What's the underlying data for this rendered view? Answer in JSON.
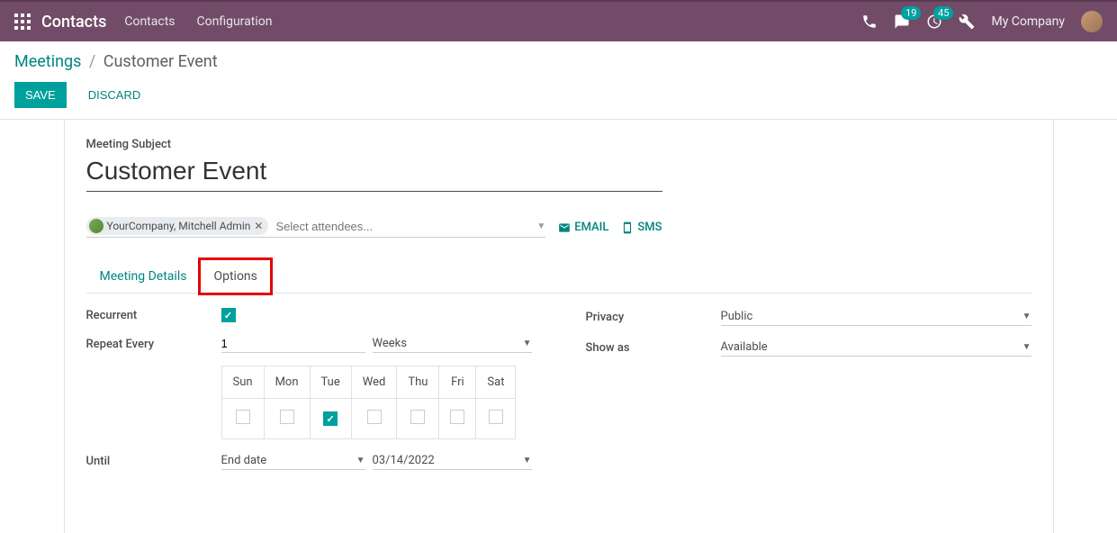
{
  "navbar": {
    "brand": "Contacts",
    "links": [
      "Contacts",
      "Configuration"
    ],
    "chat_badge": "19",
    "activity_badge": "45",
    "company": "My Company"
  },
  "breadcrumb": {
    "parent": "Meetings",
    "current": "Customer Event"
  },
  "actions": {
    "save": "SAVE",
    "discard": "DISCARD"
  },
  "form": {
    "subject_label": "Meeting Subject",
    "subject_value": "Customer Event",
    "attendee_tag": "YourCompany, Mitchell Admin",
    "attendee_placeholder": "Select attendees...",
    "email_btn": "EMAIL",
    "sms_btn": "SMS"
  },
  "tabs": {
    "details": "Meeting Details",
    "options": "Options"
  },
  "options": {
    "recurrent_label": "Recurrent",
    "repeat_label": "Repeat Every",
    "repeat_value": "1",
    "repeat_unit": "Weeks",
    "days": [
      "Sun",
      "Mon",
      "Tue",
      "Wed",
      "Thu",
      "Fri",
      "Sat"
    ],
    "until_label": "Until",
    "until_type": "End date",
    "until_date": "03/14/2022",
    "privacy_label": "Privacy",
    "privacy_value": "Public",
    "showas_label": "Show as",
    "showas_value": "Available"
  }
}
